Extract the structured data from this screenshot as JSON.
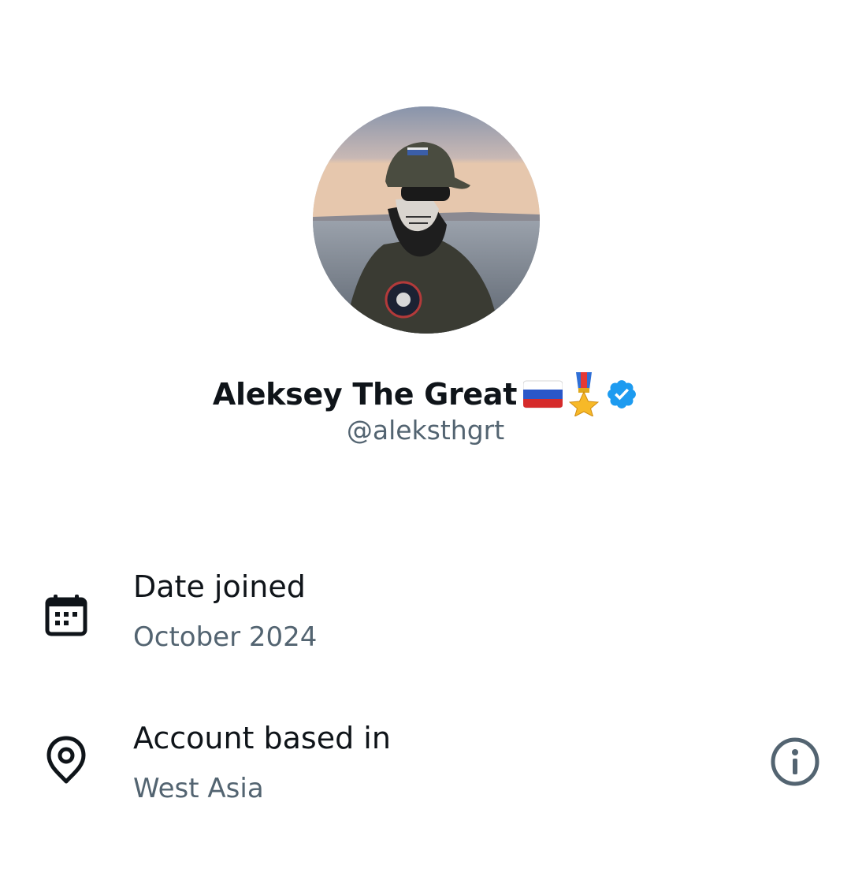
{
  "profile": {
    "display_name": "Aleksey The Great",
    "handle": "@aleksthgrt",
    "verified": true,
    "badges": [
      "russia-flag-icon",
      "military-medal-icon",
      "verified-badge-icon"
    ],
    "accent_color": "#1d9bf0"
  },
  "about": {
    "date_joined": {
      "icon": "calendar-icon",
      "label": "Date joined",
      "value": "October 2024"
    },
    "location": {
      "icon": "location-pin-icon",
      "label": "Account based in",
      "value": "West Asia",
      "info_icon": "info-icon"
    }
  },
  "colors": {
    "primary_text": "#0f1419",
    "secondary_text": "#536471",
    "background": "#ffffff"
  }
}
